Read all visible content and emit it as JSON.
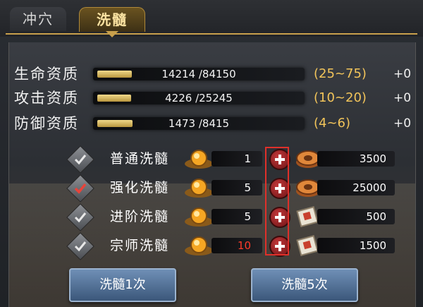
{
  "tabs": [
    {
      "label": "冲穴"
    },
    {
      "label": "洗髓"
    }
  ],
  "stats": [
    {
      "label": "生命资质",
      "value": "14214 /84150",
      "fill": 0.169,
      "range": "(25~75)",
      "bonus": "+0"
    },
    {
      "label": "攻击资质",
      "value": "4226 /25245",
      "fill": 0.167,
      "range": "(10~20)",
      "bonus": "+0"
    },
    {
      "label": "防御资质",
      "value": "1473 /8415",
      "fill": 0.175,
      "range": "(4~6)",
      "bonus": "+0"
    }
  ],
  "options": [
    {
      "label": "普通洗髓",
      "checked": false,
      "cost": "1",
      "cost_red": false,
      "res_icon": "copper-coin-icon",
      "res_amount": "3500"
    },
    {
      "label": "强化洗髓",
      "checked": true,
      "cost": "5",
      "cost_red": false,
      "res_icon": "copper-coin-icon",
      "res_amount": "25000"
    },
    {
      "label": "进阶洗髓",
      "checked": false,
      "cost": "5",
      "cost_red": false,
      "res_icon": "scroll-icon",
      "res_amount": "500"
    },
    {
      "label": "宗师洗髓",
      "checked": false,
      "cost": "10",
      "cost_red": true,
      "res_icon": "scroll-icon",
      "res_amount": "1500"
    }
  ],
  "buttons": {
    "wash_once": "洗髓1次",
    "wash_five": "洗髓5次"
  },
  "colors": {
    "accent": "#c8a04c",
    "range_text": "#f2c45a",
    "cost_red": "#ff3a2a",
    "highlight": "#e0302a"
  }
}
